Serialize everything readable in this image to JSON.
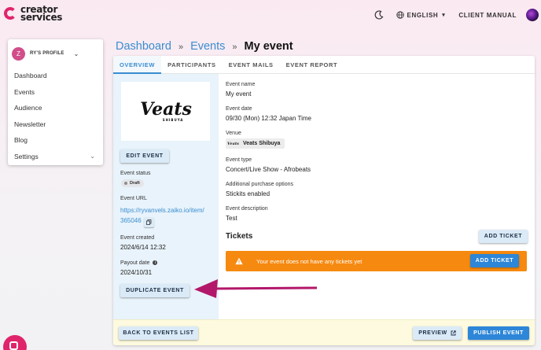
{
  "brand": {
    "line1": "creator",
    "line2": "services",
    "accent": "#e0246b"
  },
  "topbar": {
    "language": "ENGLISH",
    "manual": "CLIENT MANUAL",
    "icons": [
      "moon-icon",
      "globe-icon"
    ]
  },
  "profile": {
    "initial": "Z",
    "name": "RY'S PROFILE"
  },
  "sidebar": {
    "items": [
      {
        "label": "Dashboard"
      },
      {
        "label": "Events"
      },
      {
        "label": "Audience"
      },
      {
        "label": "Newsletter"
      },
      {
        "label": "Blog"
      },
      {
        "label": "Settings"
      }
    ]
  },
  "breadcrumb": {
    "dashboard": "Dashboard",
    "events": "Events",
    "separator": "»",
    "current": "My event"
  },
  "tabs": [
    {
      "label": "OVERVIEW"
    },
    {
      "label": "PARTICIPANTS"
    },
    {
      "label": "EVENT MAILS"
    },
    {
      "label": "EVENT REPORT"
    }
  ],
  "left": {
    "image_text": "Veats",
    "image_subtext": "SHIBUYA",
    "edit_button": "EDIT EVENT",
    "status_label": "Event status",
    "status_value": "Draft",
    "url_label": "Event URL",
    "url_line1": "https://ryvanvels.zaiko.io/item/",
    "url_line2": "365046",
    "created_label": "Event created",
    "created_value": "2024/6/14 12:32",
    "payout_label": "Payout date",
    "payout_value": "2024/10/31",
    "duplicate_button": "DUPLICATE EVENT"
  },
  "details": {
    "name_label": "Event name",
    "name_value": "My event",
    "date_label": "Event date",
    "date_value": "09/30 (Mon) 12:32 Japan Time",
    "venue_label": "Venue",
    "venue_value": "Veats Shibuya",
    "venue_logo": "Veats",
    "type_label": "Event type",
    "type_value": "Concert/Live Show - Afrobeats",
    "options_label": "Additional purchase options",
    "options_value": "Stickits enabled",
    "desc_label": "Event description",
    "desc_value": "Test"
  },
  "tickets": {
    "title": "Tickets",
    "add_button": "ADD TICKET",
    "warning": "Your event does not have any tickets yet",
    "warning_button": "ADD TICKET",
    "warning_color": "#f6890f"
  },
  "footer": {
    "back": "BACK TO EVENTS LIST",
    "preview": "PREVIEW",
    "publish": "PUBLISH EVENT"
  },
  "annotation": {
    "arrow_color": "#b3176a"
  }
}
